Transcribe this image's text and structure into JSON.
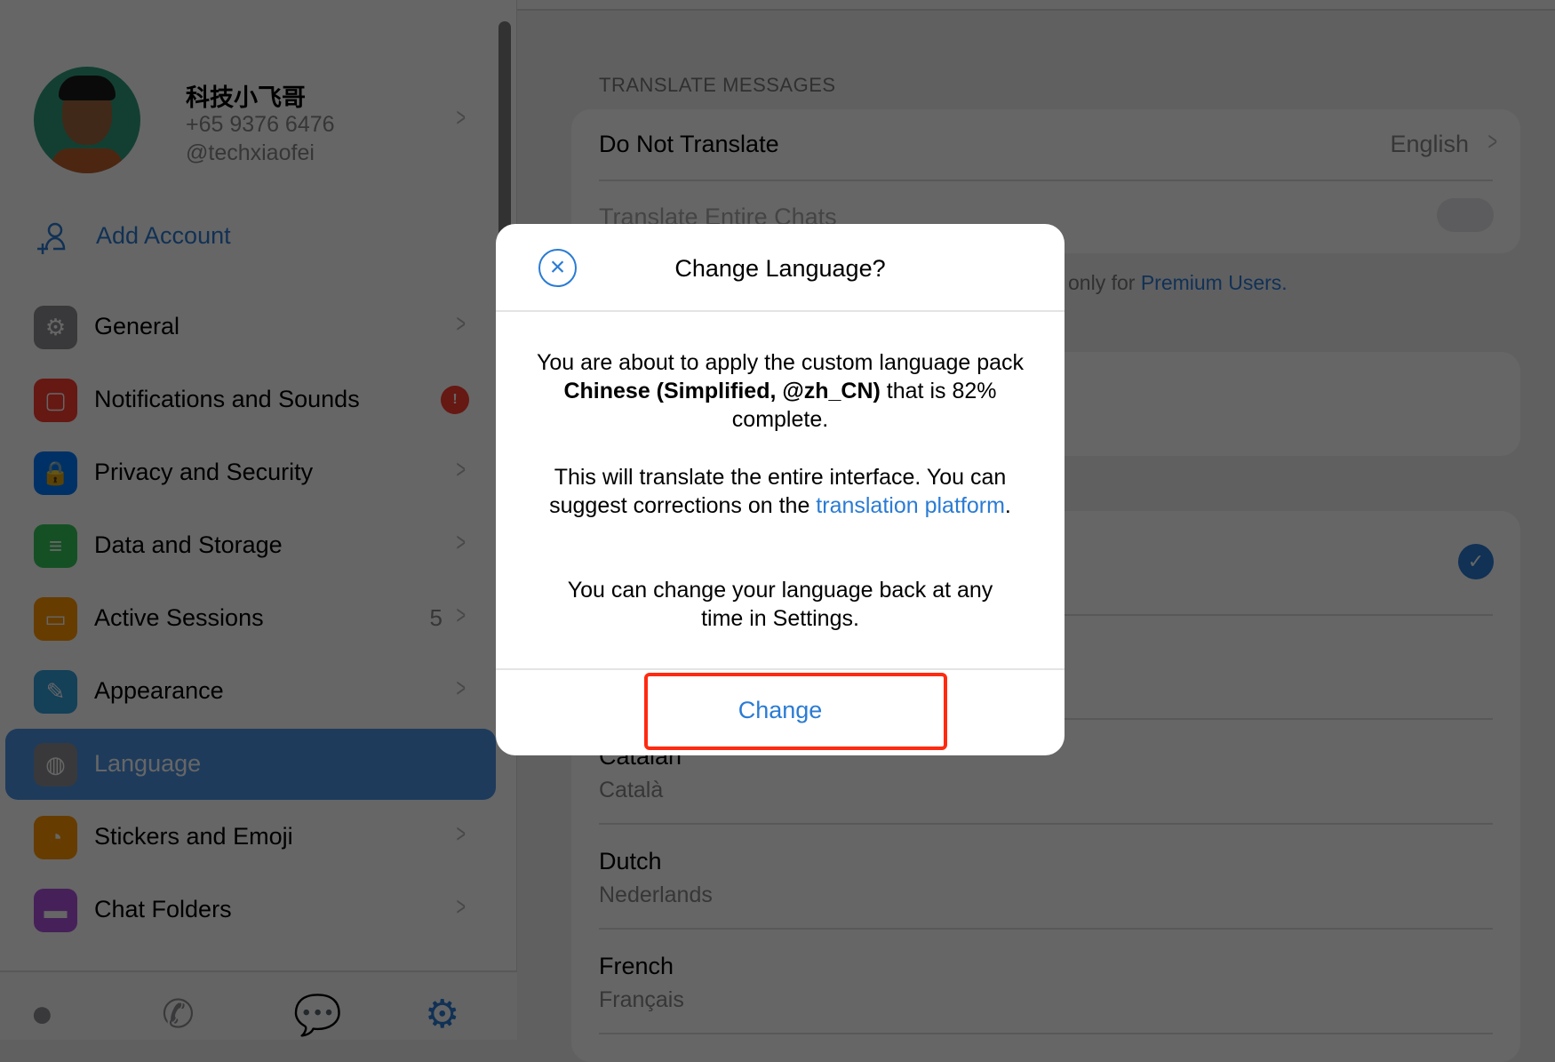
{
  "profile": {
    "name": "科技小飞哥",
    "phone": "+65 9376 6476",
    "username": "@techxiaofei"
  },
  "add_account": "Add Account",
  "menu": [
    {
      "label": "General",
      "icon": "gear-icon",
      "color": "#8e8e93",
      "glyph": "⚙"
    },
    {
      "label": "Notifications and Sounds",
      "icon": "notification-icon",
      "color": "#ff3b30",
      "glyph": "▢",
      "badge": "!"
    },
    {
      "label": "Privacy and Security",
      "icon": "lock-icon",
      "color": "#007aff",
      "glyph": "🔒"
    },
    {
      "label": "Data and Storage",
      "icon": "database-icon",
      "color": "#34c759",
      "glyph": "≡"
    },
    {
      "label": "Active Sessions",
      "icon": "laptop-icon",
      "color": "#ff9500",
      "glyph": "▭",
      "count": "5"
    },
    {
      "label": "Appearance",
      "icon": "brush-icon",
      "color": "#32a0dc",
      "glyph": "✎"
    },
    {
      "label": "Language",
      "icon": "globe-icon",
      "color": "#8e8e93",
      "glyph": "◍",
      "selected": true
    },
    {
      "label": "Stickers and Emoji",
      "icon": "sticker-icon",
      "color": "#ff9500",
      "glyph": "◔"
    },
    {
      "label": "Chat Folders",
      "icon": "folder-icon",
      "color": "#af52de",
      "glyph": "▬"
    }
  ],
  "tabbar": [
    "contacts-icon",
    "calls-icon",
    "chats-icon",
    "settings-icon"
  ],
  "right": {
    "section": "TRANSLATE MESSAGES",
    "do_not_translate": "Do Not Translate",
    "do_not_translate_value": "English",
    "translate_chats": "Translate Entire Chats",
    "premium_note": "only for ",
    "premium_link": "Premium Users.",
    "languages": [
      {
        "name": "Catalan",
        "native": "Català"
      },
      {
        "name": "Dutch",
        "native": "Nederlands"
      },
      {
        "name": "French",
        "native": "Français"
      }
    ]
  },
  "modal": {
    "title": "Change Language?",
    "p1_a": "You are about to apply the custom language pack ",
    "p1_bold": "Chinese (Simplified, @zh_CN)",
    "p1_b": " that is 82% complete.",
    "p2_a": "This will translate the entire interface. You can suggest corrections on the ",
    "p2_link": "translation platform",
    "p2_b": ".",
    "p3": "You can change your language back at any time in Settings.",
    "button": "Change"
  },
  "colors": {
    "accent": "#2a7bd4",
    "highlight": "#ff2a10"
  }
}
